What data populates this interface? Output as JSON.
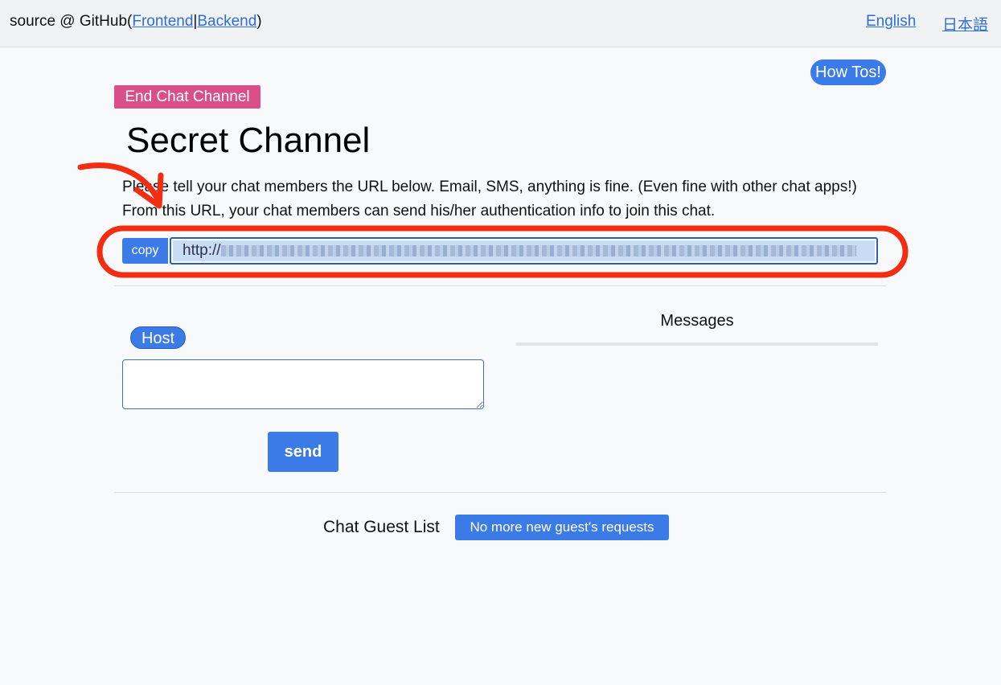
{
  "header": {
    "source_prefix": "source @ GitHub(",
    "frontend_link": "Frontend",
    "separator": "|",
    "backend_link": "Backend",
    "source_suffix": ")",
    "lang_en": "English",
    "lang_ja": "日本語"
  },
  "howto_label": "How Tos!",
  "end_chat_label": "End Chat Channel",
  "page_title": "Secret Channel",
  "description": "Please tell your chat members the URL below. Email, SMS, anything is fine. (Even fine with other chat apps!) From this URL, your chat members can send his/her authentication info to join this chat.",
  "share": {
    "copy_label": "copy",
    "url_prefix": "http://"
  },
  "host_badge": "Host",
  "messages_label": "Messages",
  "message_input": {
    "value": ""
  },
  "send_label": "send",
  "guest_list_label": "Chat Guest List",
  "guest_requests_button": "No more new guest's requests",
  "colors": {
    "primary": "#3b7be8",
    "danger_pink": "#d94f8a",
    "annotation_red": "#f22d12"
  }
}
